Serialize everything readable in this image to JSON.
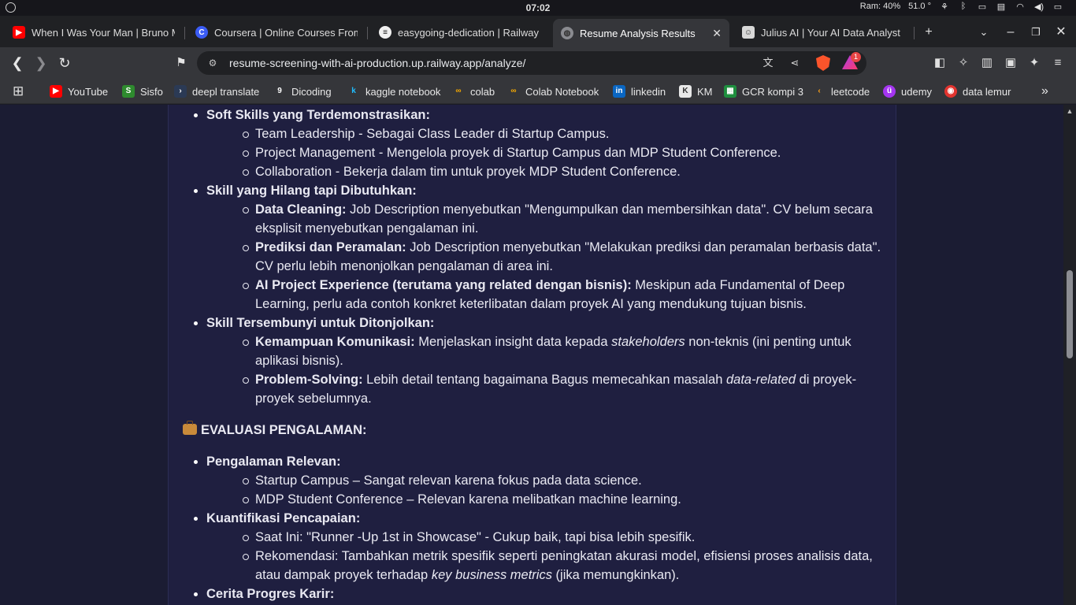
{
  "os_bar": {
    "time": "07:02",
    "ram": "Ram: 40%",
    "temp": "51.0 °"
  },
  "tabs": [
    {
      "title": "When I Was Your Man | Bruno M",
      "favicon": "youtube-icon",
      "color": "#ff0000"
    },
    {
      "title": "Coursera | Online Courses From",
      "favicon": "coursera-icon",
      "color": "#3b5cf5"
    },
    {
      "title": "easygoing-dedication | Railway",
      "favicon": "railway-icon",
      "color": "#ffffff"
    },
    {
      "title": "Resume Analysis Results",
      "favicon": "globe-icon",
      "active": true
    },
    {
      "title": "Julius AI | Your AI Data Analyst",
      "favicon": "julius-icon",
      "color": "#d8d8d8"
    }
  ],
  "toolbar": {
    "url": "resume-screening-with-ai-production.up.railway.app/analyze/",
    "notification_count": "1"
  },
  "bookmarks": [
    {
      "label": "YouTube",
      "icon": "youtube-icon",
      "color": "#ff0000"
    },
    {
      "label": "Sisfo",
      "icon": "sisfo-icon",
      "color": "#2e8b2e"
    },
    {
      "label": "deepl translate",
      "icon": "deepl-icon",
      "color": "#2b3a55"
    },
    {
      "label": "Dicoding",
      "icon": "dicoding-icon",
      "color": "#35363a"
    },
    {
      "label": "kaggle notebook",
      "icon": "kaggle-icon",
      "color": "#20beff"
    },
    {
      "label": "colab",
      "icon": "colab-icon",
      "color": "#f9ab00"
    },
    {
      "label": "Colab Notebook",
      "icon": "colab-icon",
      "color": "#f9ab00"
    },
    {
      "label": "linkedin",
      "icon": "linkedin-icon",
      "color": "#0a66c2"
    },
    {
      "label": "KM",
      "icon": "km-icon",
      "color": "#e8e8e8"
    },
    {
      "label": "GCR kompi 3",
      "icon": "classroom-icon",
      "color": "#1e8e3e"
    },
    {
      "label": "leetcode",
      "icon": "leetcode-icon",
      "color": "#ffa116"
    },
    {
      "label": "udemy",
      "icon": "udemy-icon",
      "color": "#a435f0"
    },
    {
      "label": "data lemur",
      "icon": "datalemur-icon",
      "color": "#e2342f"
    }
  ],
  "content": {
    "soft_skills_heading": "Soft Skills yang Terdemonstrasikan:",
    "soft_skills": [
      "Team Leadership - Sebagai Class Leader di Startup Campus.",
      "Project Management - Mengelola proyek di Startup Campus dan MDP Student Conference.",
      "Collaboration - Bekerja dalam tim untuk proyek MDP Student Conference."
    ],
    "missing_heading": "Skill yang Hilang tapi Dibutuhkan:",
    "missing": [
      {
        "title": "Data Cleaning:",
        "text": " Job Description menyebutkan \"Mengumpulkan dan membersihkan data\". CV belum secara eksplisit menyebutkan pengalaman ini."
      },
      {
        "title": "Prediksi dan Peramalan:",
        "text": " Job Description menyebutkan \"Melakukan prediksi dan peramalan berbasis data\". CV perlu lebih menonjolkan pengalaman di area ini."
      },
      {
        "title": "AI Project Experience (terutama yang related dengan bisnis):",
        "text": " Meskipun ada Fundamental of Deep Learning, perlu ada contoh konkret keterlibatan dalam proyek AI yang mendukung tujuan bisnis."
      }
    ],
    "hidden_heading": "Skill Tersembunyi untuk Ditonjolkan:",
    "hidden": [
      {
        "title": "Kemampuan Komunikasi:",
        "pre": " Menjelaskan insight data kepada ",
        "em": "stakeholders",
        "post": " non-teknis (ini penting untuk aplikasi bisnis)."
      },
      {
        "title": "Problem-Solving:",
        "pre": " Lebih detail tentang bagaimana Bagus memecahkan masalah ",
        "em": "data-related",
        "post": " di proyek-proyek sebelumnya."
      }
    ],
    "experience_section": "EVALUASI PENGALAMAN:",
    "relevant_heading": "Pengalaman Relevan:",
    "relevant": [
      "Startup Campus – Sangat relevan karena fokus pada data science.",
      "MDP Student Conference – Relevan karena melibatkan machine learning."
    ],
    "quant_heading": "Kuantifikasi Pencapaian:",
    "quant_current": "Saat Ini: \"Runner -Up 1st in Showcase\" - Cukup baik, tapi bisa lebih spesifik.",
    "quant_rec_pre": "Rekomendasi: Tambahkan metrik spesifik seperti peningkatan akurasi model, efisiensi proses analisis data, atau dampak proyek terhadap ",
    "quant_rec_em": "key business metrics",
    "quant_rec_post": " (jika memungkinkan).",
    "career_heading": "Cerita Progres Karir:"
  }
}
